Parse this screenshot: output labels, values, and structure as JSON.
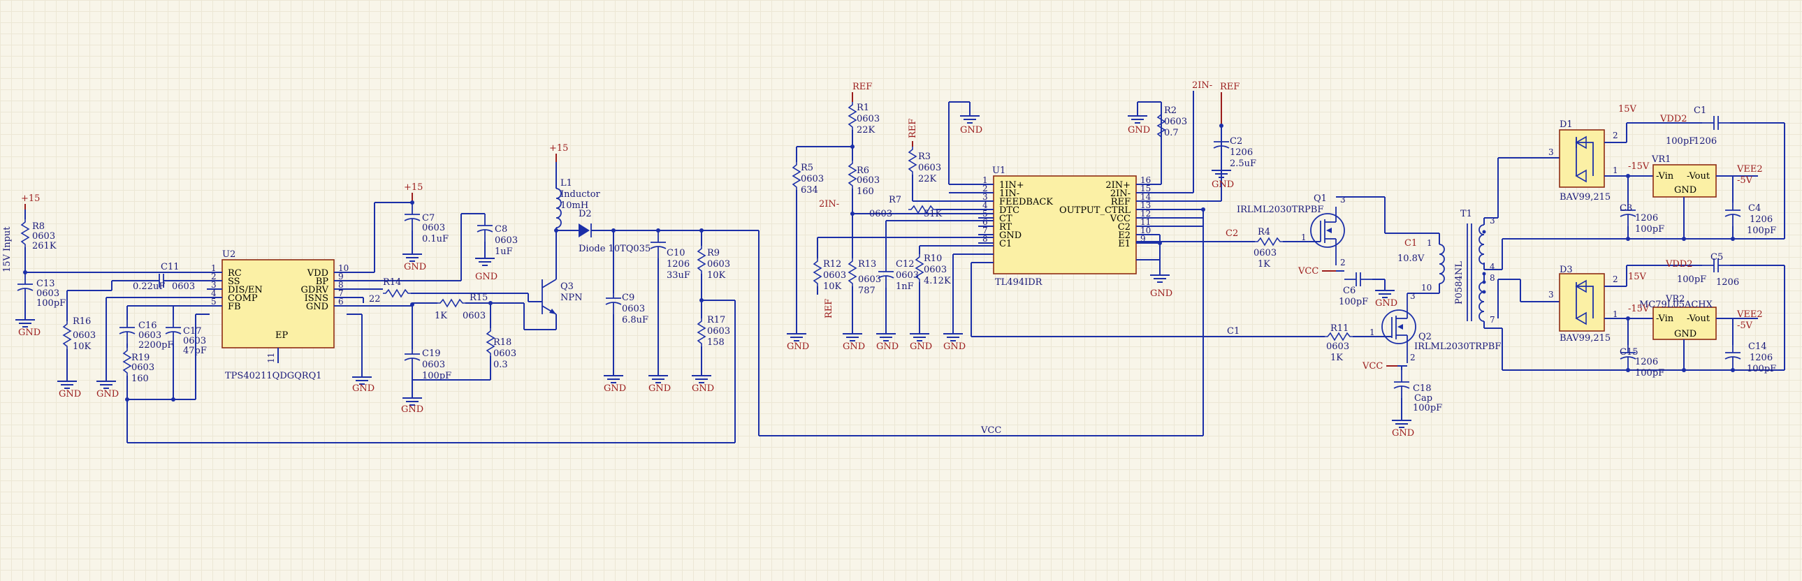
{
  "power": {
    "p15": "+15",
    "ref": "REF",
    "gnd": "GND",
    "v15": "15V",
    "vdd2": "VDD2",
    "vee2": "VEE2",
    "n15v": "-15V",
    "n5v": "-5V",
    "vcc": "VCC",
    "in2n": "2IN-"
  },
  "nets": {
    "c1": "C1",
    "c2": "C2",
    "vcc": "VCC",
    "input": "15V Input",
    "v108": "10.8V"
  },
  "parts": {
    "r8": {
      "ref": "R8",
      "pkg": "0603",
      "val": "261K"
    },
    "c13": {
      "ref": "C13",
      "pkg": "0603",
      "val": "100pF"
    },
    "r16": {
      "ref": "R16",
      "pkg": "0603",
      "val": "10K"
    },
    "c11": {
      "ref": "C11",
      "val": "0.22uF",
      "pkg": "0603"
    },
    "c16": {
      "ref": "C16",
      "pkg": "0603",
      "val": "2200pF"
    },
    "c17": {
      "ref": "C17",
      "pkg": "0603",
      "val": "47pF"
    },
    "r19": {
      "ref": "R19",
      "pkg": "0603",
      "val": "160"
    },
    "c7": {
      "ref": "C7",
      "pkg": "0603",
      "val": "0.1uF"
    },
    "c8": {
      "ref": "C8",
      "pkg": "0603",
      "val": "1uF"
    },
    "r14": {
      "ref": "R14",
      "pkg": "0603",
      "val": "22"
    },
    "r15": {
      "ref": "R15",
      "val": "1K",
      "pkg": "0603"
    },
    "c19": {
      "ref": "C19",
      "pkg": "0603",
      "val": "100pF"
    },
    "r18": {
      "ref": "R18",
      "pkg": "0603",
      "val": "0.3"
    },
    "q3": {
      "ref": "Q3",
      "val": "NPN"
    },
    "l1": {
      "ref": "L1",
      "type": "Inductor",
      "val": "10mH"
    },
    "d2": {
      "ref": "D2",
      "val": "Diode 10TQ035"
    },
    "c9": {
      "ref": "C9",
      "pkg": "0603",
      "val": "6.8uF"
    },
    "c10": {
      "ref": "C10",
      "pkg": "1206",
      "val": "33uF"
    },
    "r9": {
      "ref": "R9",
      "pkg": "0603",
      "val": "10K"
    },
    "r17": {
      "ref": "R17",
      "pkg": "0603",
      "val": "158"
    },
    "r1": {
      "ref": "R1",
      "pkg": "0603",
      "val": "22K"
    },
    "r6": {
      "ref": "R6",
      "pkg": "0603",
      "val": "160"
    },
    "r5": {
      "ref": "R5",
      "pkg": "0603",
      "val": "634"
    },
    "r3": {
      "ref": "R3",
      "pkg": "0603",
      "val": "22K"
    },
    "r7": {
      "ref": "R7",
      "pkg": "0603",
      "val": "51K"
    },
    "r12": {
      "ref": "R12",
      "pkg": "0603",
      "val": "10K"
    },
    "r13": {
      "ref": "R13",
      "pkg": "0603",
      "val": "787"
    },
    "c12": {
      "ref": "C12",
      "pkg": "0603",
      "val": "1nF"
    },
    "r10": {
      "ref": "R10",
      "pkg": "0603",
      "val": "4.12K"
    },
    "r2": {
      "ref": "R2",
      "pkg": "0603",
      "val": "0.7"
    },
    "c2": {
      "ref": "C2",
      "pkg": "1206",
      "val": "2.5uF"
    },
    "q1": {
      "ref": "Q1",
      "val": "IRLML2030TRPBF"
    },
    "q2": {
      "ref": "Q2",
      "val": "IRLML2030TRPBF"
    },
    "r4": {
      "ref": "R4",
      "pkg": "0603",
      "val": "1K"
    },
    "r11": {
      "ref": "R11",
      "pkg": "0603",
      "val": "1K"
    },
    "c6": {
      "ref": "C6",
      "type": "Cap",
      "val": "100pF"
    },
    "c18": {
      "ref": "C18",
      "type": "Cap",
      "val": "100pF"
    },
    "t1": {
      "ref": "T1",
      "val": "P0584NL"
    },
    "d1": {
      "ref": "D1",
      "val": "BAV99,215"
    },
    "d3": {
      "ref": "D3",
      "val": "BAV99,215"
    },
    "vr1": {
      "ref": "VR1"
    },
    "vr2": {
      "ref": "VR2",
      "val": "MC79L05ACHX"
    },
    "c1": {
      "ref": "C1",
      "val": "100pF",
      "pkg": "1206"
    },
    "c5": {
      "ref": "C5",
      "val": "100pF",
      "pkg": "1206"
    },
    "c3": {
      "ref": "C3",
      "pkg": "1206",
      "val": "100pF"
    },
    "c4": {
      "ref": "C4",
      "pkg": "1206",
      "val": "100pF"
    },
    "c15": {
      "ref": "C15",
      "pkg": "1206",
      "val": "100pF"
    },
    "c14": {
      "ref": "C14",
      "pkg": "1206",
      "val": "100pF"
    }
  },
  "u2": {
    "ref": "U2",
    "part": "TPS40211QDGQRQ1",
    "ep": "EP",
    "pin11": "11",
    "left": [
      {
        "num": "1",
        "name": "RC"
      },
      {
        "num": "2",
        "name": "SS"
      },
      {
        "num": "3",
        "name": "DIS/EN"
      },
      {
        "num": "4",
        "name": "COMP"
      },
      {
        "num": "5",
        "name": "FB"
      }
    ],
    "right": [
      {
        "num": "10",
        "name": "VDD"
      },
      {
        "num": "9",
        "name": "BP"
      },
      {
        "num": "8",
        "name": "GDRV"
      },
      {
        "num": "7",
        "name": "ISNS"
      },
      {
        "num": "6",
        "name": "GND"
      }
    ]
  },
  "u1": {
    "ref": "U1",
    "part": "TL494IDR",
    "left": [
      {
        "num": "1",
        "name": "1IN+"
      },
      {
        "num": "2",
        "name": "1IN-"
      },
      {
        "num": "3",
        "name": "FEEDBACK"
      },
      {
        "num": "4",
        "name": "DTC"
      },
      {
        "num": "5",
        "name": "CT"
      },
      {
        "num": "6",
        "name": "RT"
      },
      {
        "num": "7",
        "name": "GND"
      },
      {
        "num": "8",
        "name": "C1"
      }
    ],
    "right": [
      {
        "num": "16",
        "name": "2IN+"
      },
      {
        "num": "15",
        "name": "2IN-"
      },
      {
        "num": "14",
        "name": "REF"
      },
      {
        "num": "13",
        "name": "OUTPUT_CTRL"
      },
      {
        "num": "12",
        "name": "VCC"
      },
      {
        "num": "11",
        "name": "C2"
      },
      {
        "num": "10",
        "name": "E2"
      },
      {
        "num": "9",
        "name": "E1"
      }
    ]
  },
  "vreg": {
    "vin": "-Vin",
    "vout": "-Vout",
    "gnd": "GND"
  },
  "pins": {
    "p1": "1",
    "p2": "2",
    "p3": "3",
    "p4": "4",
    "p7": "7",
    "p8": "8",
    "p10": "10"
  }
}
